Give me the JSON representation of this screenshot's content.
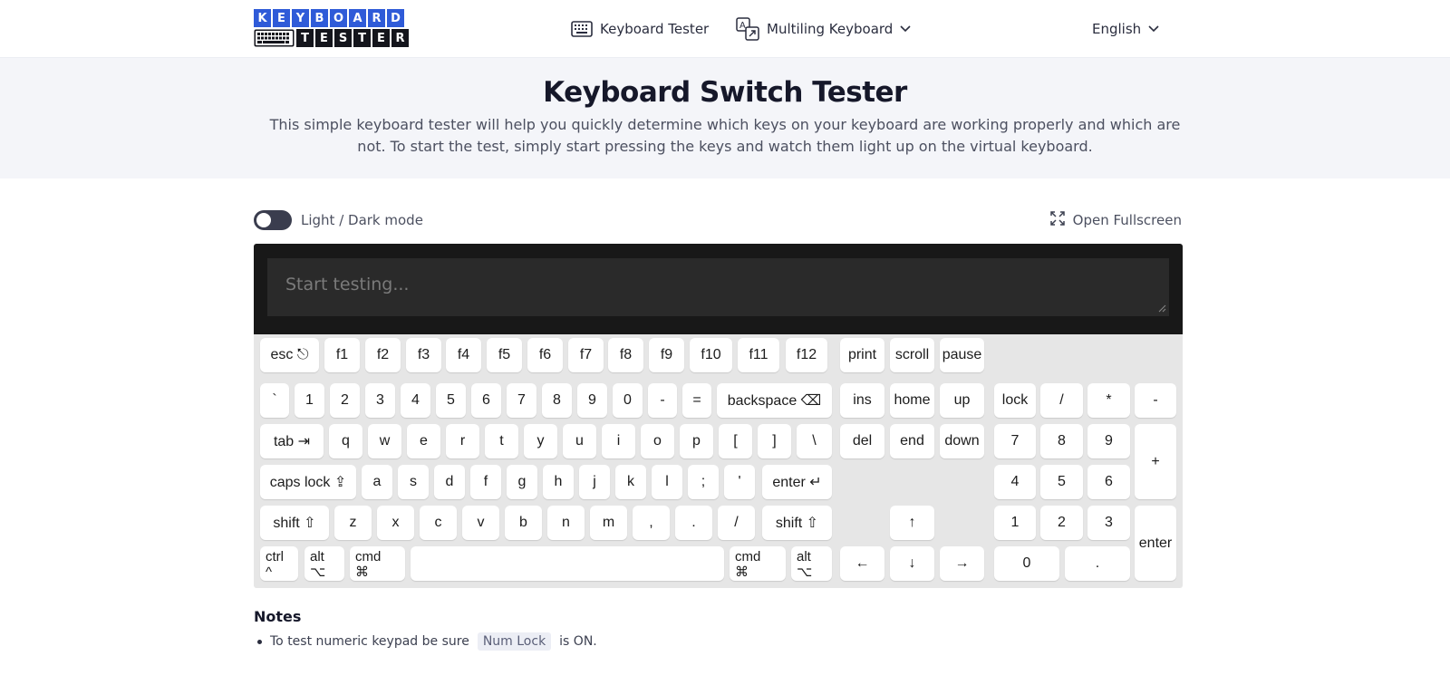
{
  "header": {
    "logo_top": [
      "K",
      "E",
      "Y",
      "B",
      "O",
      "A",
      "R",
      "D"
    ],
    "logo_bottom": [
      "T",
      "E",
      "S",
      "T",
      "E",
      "R"
    ],
    "nav_keyboard_tester": "Keyboard Tester",
    "nav_multiling": "Multiling Keyboard",
    "nav_language": "English"
  },
  "hero": {
    "title": "Keyboard Switch Tester",
    "description": "This simple keyboard tester will help you quickly determine which keys on your keyboard are working properly and which are not. To start the test, simply start pressing the keys and watch them light up on the virtual keyboard."
  },
  "controls": {
    "mode_label": "Light / Dark mode",
    "fullscreen_label": "Open Fullscreen"
  },
  "tester": {
    "placeholder": "Start testing..."
  },
  "keys": {
    "esc": "esc ⎋",
    "f1": "f1",
    "f2": "f2",
    "f3": "f3",
    "f4": "f4",
    "f5": "f5",
    "f6": "f6",
    "f7": "f7",
    "f8": "f8",
    "f9": "f9",
    "f10": "f10",
    "f11": "f11",
    "f12": "f12",
    "print": "print",
    "scroll": "scroll",
    "pause": "pause",
    "backtick": "`",
    "d1": "1",
    "d2": "2",
    "d3": "3",
    "d4": "4",
    "d5": "5",
    "d6": "6",
    "d7": "7",
    "d8": "8",
    "d9": "9",
    "d0": "0",
    "minus": "-",
    "equals": "=",
    "backspace": "backspace ⌫",
    "ins": "ins",
    "home": "home",
    "up": "up",
    "lock": "lock",
    "np_slash": "/",
    "np_star": "*",
    "np_minus": "-",
    "tab": "tab ⇥",
    "q": "q",
    "w": "w",
    "e": "e",
    "r": "r",
    "t": "t",
    "y": "y",
    "u": "u",
    "i": "i",
    "o": "o",
    "p": "p",
    "lbracket": "[",
    "rbracket": "]",
    "backslash": "\\",
    "del": "del",
    "end": "end",
    "down": "down",
    "np7": "7",
    "np8": "8",
    "np9": "9",
    "np_plus": "+",
    "caps": "caps lock ⇪",
    "a": "a",
    "s": "s",
    "d": "d",
    "f": "f",
    "g": "g",
    "h": "h",
    "j": "j",
    "k": "k",
    "l": "l",
    "semicolon": ";",
    "quote": "'",
    "enter": "enter ↵",
    "np4": "4",
    "np5": "5",
    "np6": "6",
    "lshift": "shift ⇧",
    "z": "z",
    "x": "x",
    "c": "c",
    "v": "v",
    "b": "b",
    "n": "n",
    "m": "m",
    "comma": ",",
    "period": ".",
    "slash": "/",
    "rshift": "shift ⇧",
    "arrow_up": "↑",
    "np1": "1",
    "np2": "2",
    "np3": "3",
    "np_enter": "enter",
    "lctrl_1": "ctrl",
    "lctrl_2": "^",
    "lalt_1": "alt",
    "lalt_2": "⌥",
    "lcmd_1": "cmd",
    "lcmd_2": "⌘",
    "space": "",
    "rcmd_1": "cmd",
    "rcmd_2": "⌘",
    "ralt_1": "alt",
    "ralt_2": "⌥",
    "arrow_left": "←",
    "arrow_down": "↓",
    "arrow_right": "→",
    "np0": "0",
    "np_dot": "."
  },
  "notes": {
    "title": "Notes",
    "item_prefix": "To test numeric keypad be sure",
    "item_chip": "Num Lock",
    "item_suffix": "is ON."
  },
  "colors": {
    "accent": "#2f5bd8",
    "panel": "#181818",
    "keyboard_bg": "#e6e6e6"
  }
}
